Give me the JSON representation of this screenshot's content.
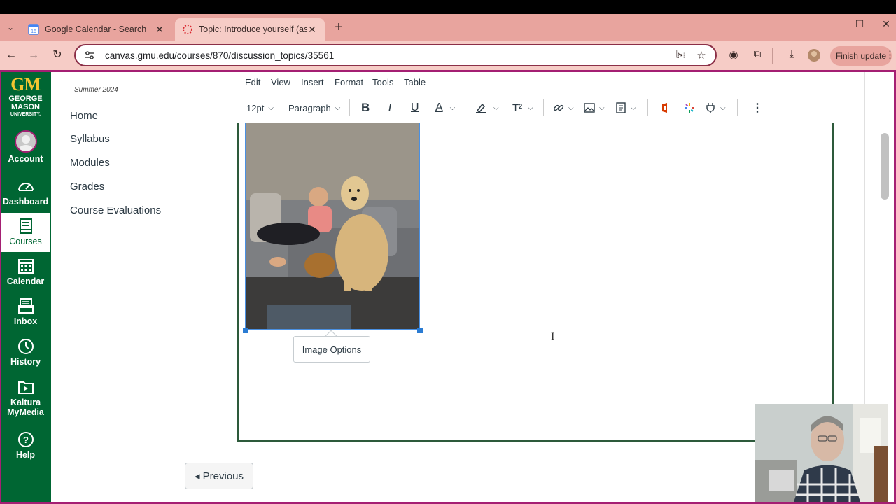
{
  "browser": {
    "tabs": [
      {
        "title": "Google Calendar - Search",
        "favicon": "google-calendar-icon",
        "favicon_text": "16",
        "active": false
      },
      {
        "title": "Topic: Introduce yourself (assign",
        "favicon": "canvas-icon",
        "active": true
      }
    ],
    "url": "canvas.gmu.edu/courses/870/discussion_topics/35561",
    "finish_update_label": "Finish update"
  },
  "global_nav": {
    "logo": {
      "mark": "GM",
      "line1": "GEORGE",
      "line2": "MASON",
      "line3": "UNIVERSITY."
    },
    "items": [
      {
        "label": "Account",
        "icon": "avatar-icon"
      },
      {
        "label": "Dashboard",
        "icon": "dashboard-icon"
      },
      {
        "label": "Courses",
        "icon": "courses-icon",
        "active": true
      },
      {
        "label": "Calendar",
        "icon": "calendar-icon"
      },
      {
        "label": "Inbox",
        "icon": "inbox-icon"
      },
      {
        "label": "History",
        "icon": "history-icon"
      },
      {
        "label": "Kaltura MyMedia",
        "icon": "kaltura-icon"
      },
      {
        "label": "Help",
        "icon": "help-icon"
      }
    ],
    "colors": {
      "background": "#006633",
      "accent": "#f3c530"
    }
  },
  "course_nav": {
    "term": "Summer 2024",
    "items": [
      "Home",
      "Syllabus",
      "Modules",
      "Grades",
      "Course Evaluations"
    ]
  },
  "editor": {
    "menu": [
      "Edit",
      "View",
      "Insert",
      "Format",
      "Tools",
      "Table"
    ],
    "toolbar": {
      "font_size": "12pt",
      "block_format": "Paragraph",
      "bold": "B",
      "italic": "I",
      "underline": "U",
      "text_color": "A",
      "superscript": "T²"
    },
    "image_options_label": "Image Options"
  },
  "footer": {
    "previous_label": "◂ Previous"
  }
}
